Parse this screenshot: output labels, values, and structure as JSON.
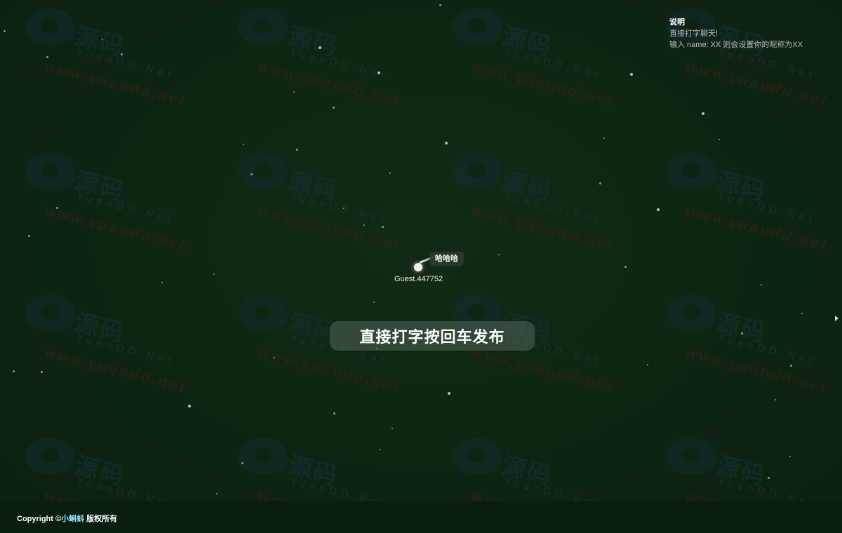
{
  "help": {
    "title": "说明",
    "line1": "直接打字聊天!",
    "line2": "输入 name: XX 则会设置你的昵称为XX"
  },
  "player": {
    "name": "Guest.447752",
    "message": "哈哈哈"
  },
  "hint": {
    "text": "直接打字按回车发布"
  },
  "footer": {
    "prefix": "Copyright ©",
    "brand": "小蝌蚪",
    "suffix": " 版权所有"
  },
  "watermark": {
    "brand": "源码",
    "sub": "YuanDD.Net",
    "url": "www.yuandd.net"
  },
  "colors": {
    "background": "#0e2412",
    "footer_bg": "#0b1e0e",
    "brand_link": "#8fe2ff",
    "star": "#e6f0e6"
  }
}
